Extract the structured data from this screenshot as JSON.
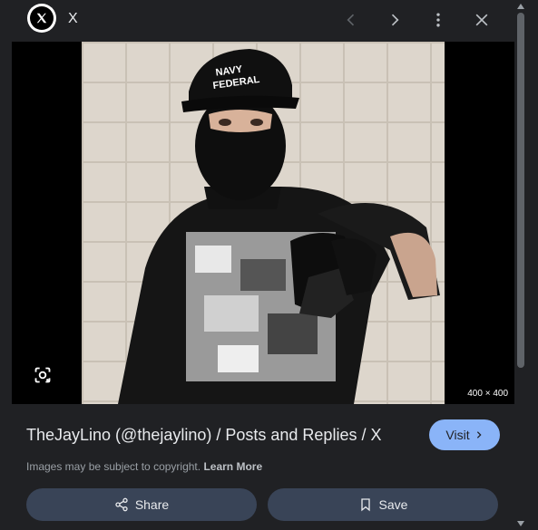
{
  "header": {
    "site_name": "X",
    "logo_icon": "x-logo-icon",
    "prev_icon": "chevron-left-icon",
    "next_icon": "chevron-right-icon",
    "more_icon": "more-vert-icon",
    "close_icon": "close-icon"
  },
  "image": {
    "dimensions": "400 × 400",
    "lens_icon": "google-lens-icon"
  },
  "result": {
    "title": "TheJayLino (@thejaylino) / Posts and Replies / X",
    "visit_label": "Visit",
    "copyright_text": "Images may be subject to copyright.",
    "learn_more": "Learn More"
  },
  "actions": {
    "share_label": "Share",
    "save_label": "Save"
  },
  "colors": {
    "background": "#202124",
    "accent": "#8ab4f8",
    "button_bg": "#394457"
  }
}
